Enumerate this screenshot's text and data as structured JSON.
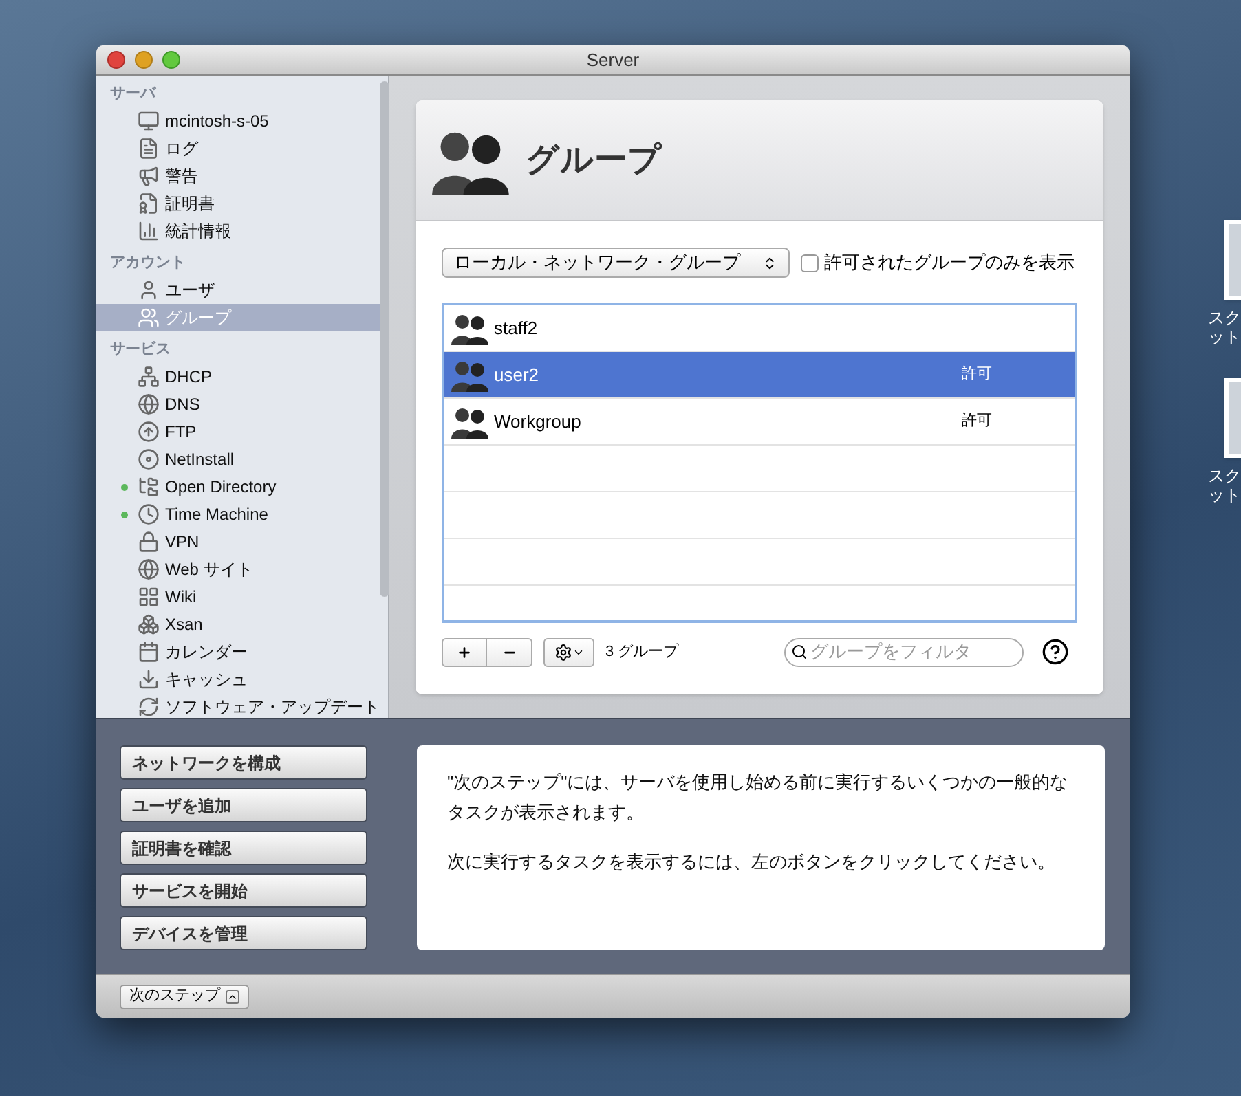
{
  "window": {
    "title": "Server"
  },
  "sidebar": {
    "sections": [
      {
        "title": "サーバ",
        "items": [
          {
            "label": "mcintosh-s-05",
            "selected": false
          },
          {
            "label": "ログ",
            "selected": false
          },
          {
            "label": "警告",
            "selected": false
          },
          {
            "label": "証明書",
            "selected": false
          },
          {
            "label": "統計情報",
            "selected": false
          }
        ]
      },
      {
        "title": "アカウント",
        "items": [
          {
            "label": "ユーザ",
            "selected": false
          },
          {
            "label": "グループ",
            "selected": true
          }
        ]
      },
      {
        "title": "サービス",
        "items": [
          {
            "label": "DHCP",
            "selected": false,
            "running": false
          },
          {
            "label": "DNS",
            "selected": false,
            "running": false
          },
          {
            "label": "FTP",
            "selected": false,
            "running": false
          },
          {
            "label": "NetInstall",
            "selected": false,
            "running": false
          },
          {
            "label": "Open Directory",
            "selected": false,
            "running": true
          },
          {
            "label": "Time Machine",
            "selected": false,
            "running": true
          },
          {
            "label": "VPN",
            "selected": false,
            "running": false
          },
          {
            "label": "Web サイト",
            "selected": false,
            "running": false
          },
          {
            "label": "Wiki",
            "selected": false,
            "running": false
          },
          {
            "label": "Xsan",
            "selected": false,
            "running": false
          },
          {
            "label": "カレンダー",
            "selected": false,
            "running": false
          },
          {
            "label": "キャッシュ",
            "selected": false,
            "running": false
          },
          {
            "label": "ソフトウェア・アップデート",
            "selected": false,
            "running": false
          }
        ]
      }
    ]
  },
  "panel": {
    "title": "グループ",
    "dropdown": {
      "value": "ローカル・ネットワーク・グループ"
    },
    "filter_checkbox": {
      "label": "許可されたグループのみを表示",
      "checked": false
    },
    "rows": [
      {
        "name": "staff2",
        "selected": false
      },
      {
        "name": "user2",
        "status": "許可",
        "selected": true
      },
      {
        "name": "Workgroup",
        "status": "許可",
        "selected": false
      }
    ],
    "count": "3 グループ",
    "search": {
      "placeholder": "グループをフィルタ"
    }
  },
  "next_steps": {
    "buttons": [
      "ネットワークを構成",
      "ユーザを追加",
      "証明書を確認",
      "サービスを開始",
      "デバイスを管理"
    ],
    "paragraphs": [
      "\"次のステップ\"には、サーバを使用し始める前に実行するいくつかの一般的なタスクが表示されます。",
      "次に実行するタスクを表示するには、左のボタンをクリックしてください。"
    ]
  },
  "bottom_bar": {
    "button": "次のステップ"
  },
  "desktop_icons": [
    {
      "lines": [
        "スク",
        "ット"
      ]
    },
    {
      "lines": [
        "スク",
        "ット"
      ]
    }
  ]
}
